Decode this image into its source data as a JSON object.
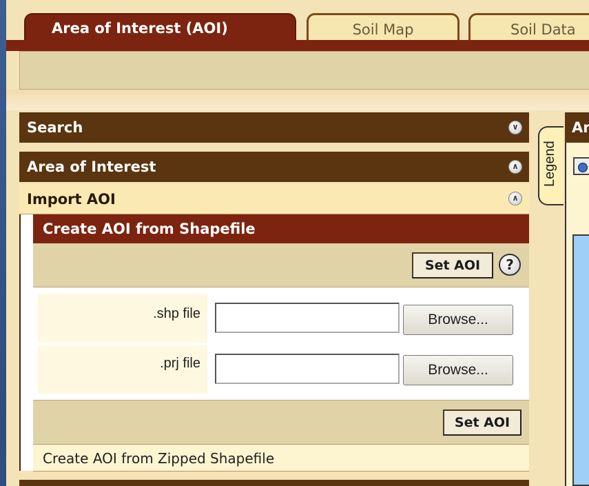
{
  "tabs": [
    {
      "label": "Area of Interest (AOI)",
      "active": true
    },
    {
      "label": "Soil Map",
      "active": false
    },
    {
      "label": "Soil Data",
      "active": false
    }
  ],
  "panels": {
    "search": {
      "label": "Search"
    },
    "aoi": {
      "label": "Area of Interest"
    },
    "import": {
      "label": "Import AOI"
    }
  },
  "shapefile": {
    "header": "Create AOI from Shapefile",
    "set_aoi_label": "Set AOI",
    "help_glyph": "?",
    "shp_label": ".shp file",
    "prj_label": ".prj file",
    "browse_label": "Browse...",
    "zipped_label": "Create AOI from Zipped Shapefile"
  },
  "legend": {
    "label": "Legend"
  },
  "right_panel": {
    "header": "Ar"
  },
  "colors": {
    "tab_active": "#7c2410",
    "panel_header": "#5a3510",
    "accent_beige": "#f3e3b6",
    "map_blue": "#9fcff6"
  }
}
